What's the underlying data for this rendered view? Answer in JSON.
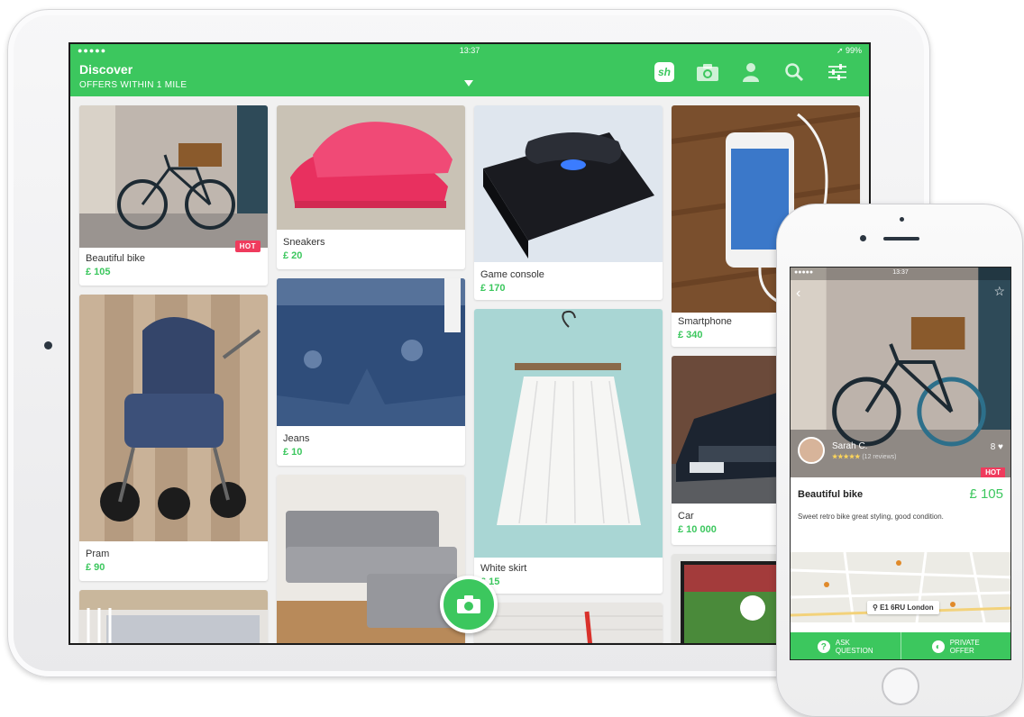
{
  "ipad": {
    "status": {
      "left": "●●●●● ",
      "time": "13:37",
      "right": "➚ 99%"
    },
    "header": {
      "title": "Discover",
      "subtitle": "OFFERS WITHIN 1 MILE"
    },
    "toolbar_icons": [
      "sh-logo-icon",
      "camera-icon",
      "profile-icon",
      "search-icon",
      "filters-icon"
    ],
    "listings": [
      {
        "name": "Beautiful bike",
        "price": "£ 105",
        "badge": "HOT"
      },
      {
        "name": "Pram",
        "price": "£ 90"
      },
      {
        "name": "Sneakers",
        "price": "£ 20"
      },
      {
        "name": "Jeans",
        "price": "£ 10"
      },
      {
        "name": "Game console",
        "price": "£ 170"
      },
      {
        "name": "White skirt",
        "price": "£ 15"
      },
      {
        "name": "Smartphone",
        "price": "£ 340"
      },
      {
        "name": "Car",
        "price": "£ 10 000"
      }
    ]
  },
  "iphone": {
    "status": {
      "left": "●●●●● ",
      "time": "13:37"
    },
    "seller": {
      "name": "Sarah C.",
      "stars": "★★★★★",
      "reviews": "(12 reviews)"
    },
    "likes": "8 ♥",
    "badge": "HOT",
    "item": {
      "title": "Beautiful bike",
      "price": "£ 105",
      "description": "Sweet retro bike great styling, good condition."
    },
    "map_label": "E1 6RU London",
    "actions": {
      "ask_line1": "ASK",
      "ask_line2": "QUESTION",
      "offer_line1": "PRIVATE",
      "offer_line2": "OFFER"
    }
  }
}
